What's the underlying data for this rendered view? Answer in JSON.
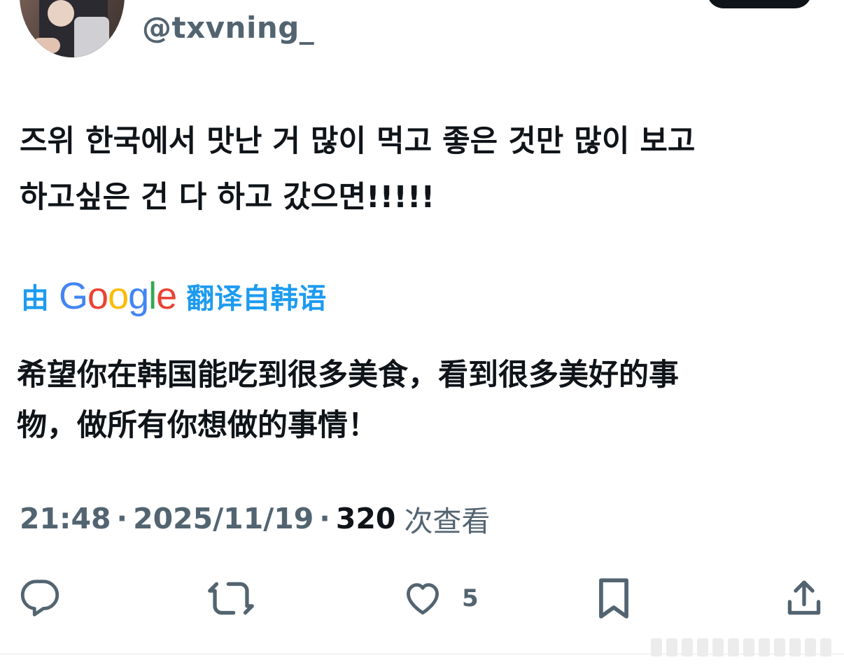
{
  "author": {
    "handle": "@txvning_"
  },
  "tweet": {
    "text_lines": [
      "즈위 한국에서 맛난 거 많이 먹고 좋은 것만 많이 보고",
      "하고싶은 건 다 하고 갔으면!!!!!"
    ]
  },
  "translation": {
    "prefix": "由",
    "provider": "Google",
    "suffix": "翻译自韩语",
    "text_lines": [
      "希望你在韩国能吃到很多美食，看到很多美好的事",
      "物，做所有你想做的事情！"
    ]
  },
  "meta": {
    "time": "21:48",
    "separator": "·",
    "date": "2025/11/19",
    "views_count": "320",
    "views_label": "次查看"
  },
  "actions": {
    "reply_icon": "reply-icon",
    "retweet_icon": "retweet-icon",
    "like_icon": "heart-icon",
    "like_count": "5",
    "bookmark_icon": "bookmark-icon",
    "share_icon": "share-icon"
  },
  "colors": {
    "text_primary": "#0f1419",
    "text_secondary": "#536471",
    "link_blue": "#1d9bf0"
  }
}
